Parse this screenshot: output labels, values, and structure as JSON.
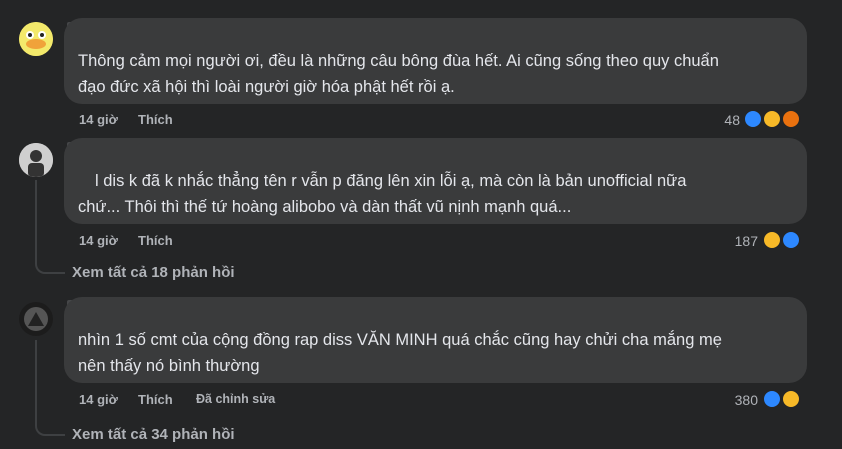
{
  "comments": [
    {
      "text_lines": [
        "Thông cảm mọi người ơi, đều là những câu bông đùa hết. Ai cũng sống theo quy chuẩn",
        "đạo đức xã hội thì loài người giờ hóa phật hết rồi ạ."
      ],
      "time": "14 giờ",
      "like_label": "Thích",
      "reaction_count": "48",
      "reactions": [
        "like-icon",
        "haha-icon",
        "angry-icon"
      ]
    },
    {
      "text_lines": [
        "l dis k đã k nhắc thẳng tên r vẫn p đăng lên xin lỗi ạ, mà còn là bản unofficial nữa",
        "chứ... Thôi thì thế tứ hoàng alibobo và dàn thất vũ nịnh mạnh quá..."
      ],
      "time": "14 giờ",
      "like_label": "Thích",
      "reaction_count": "187",
      "reactions": [
        "haha-icon",
        "like-icon"
      ],
      "replies_label": "Xem tất cả 18 phản hồi"
    },
    {
      "text_lines": [
        "nhìn 1 số cmt của cộng đồng rap diss VĂN MINH quá chắc cũng hay chửi cha mắng mẹ",
        "nên thấy nó bình thường"
      ],
      "time": "14 giờ",
      "like_label": "Thích",
      "edited_label": "Đã chỉnh sửa",
      "reaction_count": "380",
      "reactions": [
        "like-icon",
        "haha-icon"
      ],
      "replies_label": "Xem tất cả 34 phản hồi"
    }
  ],
  "colors": {
    "background": "#242526",
    "bubble": "#3a3b3c",
    "text": "#e4e6eb",
    "secondary": "#b0b3b8",
    "like": "#2d88ff",
    "haha": "#f7b928",
    "angry": "#e9710f"
  }
}
